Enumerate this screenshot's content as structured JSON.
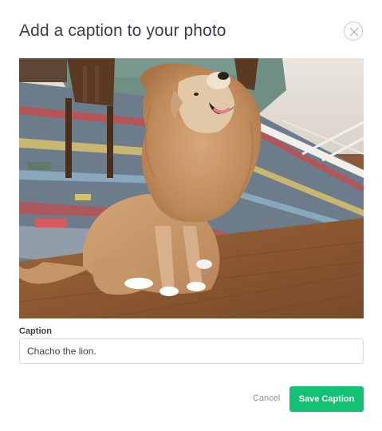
{
  "dialog": {
    "title": "Add a caption to your photo",
    "close_icon": "close-circle-icon"
  },
  "photo": {
    "subject": "dog-in-lion-mane-costume"
  },
  "caption": {
    "label": "Caption",
    "value": "Chacho the lion."
  },
  "actions": {
    "cancel_label": "Cancel",
    "save_label": "Save Caption"
  },
  "colors": {
    "accent": "#12c173",
    "title_text": "#3a3f44",
    "muted_text": "#8e9398",
    "border": "#d6d9dc"
  }
}
